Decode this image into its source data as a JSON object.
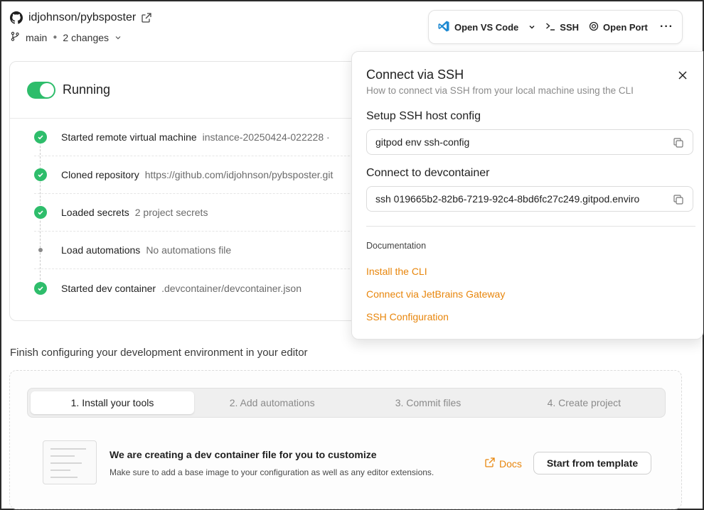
{
  "header": {
    "repo": "idjohnson/pybsposter",
    "branch": "main",
    "changes": "2 changes"
  },
  "toolbar": {
    "vscode_label": "Open VS Code",
    "ssh_label": "SSH",
    "port_label": "Open Port",
    "more": "···"
  },
  "status": {
    "label": "Running",
    "steps": [
      {
        "title": "Started remote virtual machine",
        "detail": "instance-20250424-022228 ·",
        "state": "done"
      },
      {
        "title": "Cloned repository",
        "detail": "https://github.com/idjohnson/pybsposter.git",
        "state": "done"
      },
      {
        "title": "Loaded secrets",
        "detail": "2 project secrets",
        "state": "done"
      },
      {
        "title": "Load automations",
        "detail": "No automations file",
        "state": "pending"
      },
      {
        "title": "Started dev container",
        "detail": ".devcontainer/devcontainer.json",
        "state": "done"
      }
    ]
  },
  "finish": {
    "title": "Finish configuring your development environment in your editor",
    "tabs": [
      "1. Install your tools",
      "2. Add automations",
      "3. Commit files",
      "4. Create project"
    ],
    "card_title": "We are creating a dev container file for you to customize",
    "card_sub": "Make sure to add a base image to your configuration as well as any editor extensions.",
    "docs": "Docs",
    "template_button": "Start from template"
  },
  "ssh_panel": {
    "title": "Connect via SSH",
    "subtitle": "How to connect via SSH from your local machine using the CLI",
    "setup_label": "Setup SSH host config",
    "setup_cmd": "gitpod env ssh-config",
    "connect_label": "Connect to devcontainer",
    "connect_cmd": "ssh 019665b2-82b6-7219-92c4-8bd6fc27c249.gitpod.enviro",
    "doc_heading": "Documentation",
    "links": [
      "Install the CLI",
      "Connect via JetBrains Gateway",
      "SSH Configuration"
    ]
  },
  "colors": {
    "accent": "#e8860c",
    "success": "#2ebd6b"
  }
}
